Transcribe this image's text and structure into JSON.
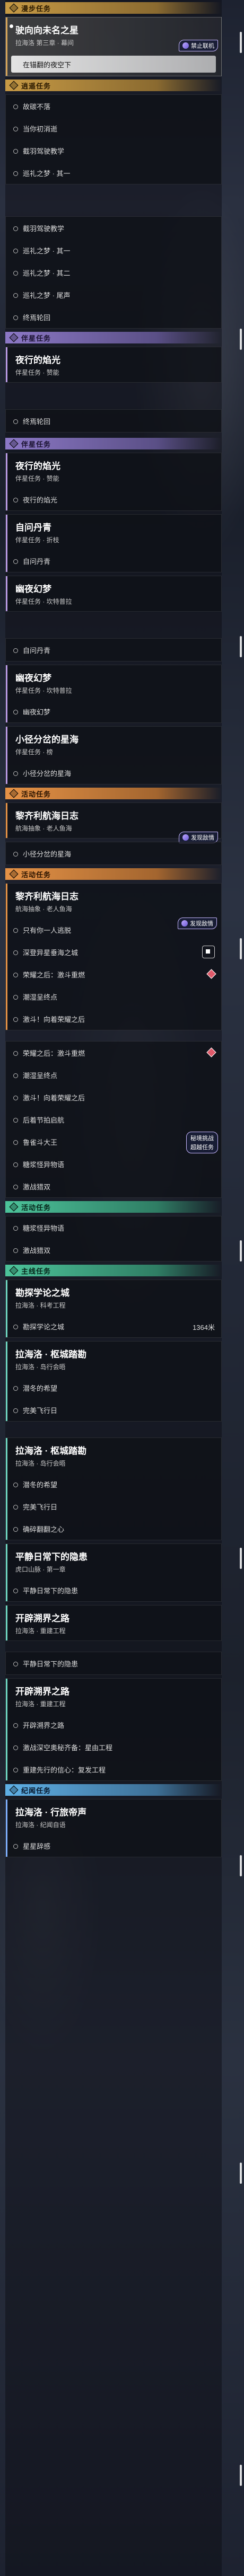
{
  "sections": {
    "daily": "漫步任务",
    "companion": "逍遥任务",
    "companion_repeat": "伴星任务",
    "activity": "活动任务",
    "main": "主线任务",
    "event": "纪闻任务"
  },
  "items": {
    "i1_title": "驶向向未名之星",
    "i1_sub": "拉海洛 第三章 · 幕间",
    "i1_tracked": "在锚翻的夜空下",
    "i2a": "故碳不落",
    "i2b": "当你初消逝",
    "i2c": "截羽驾驶教学",
    "i2d": "巡礼之梦 · 其一",
    "i3a": "截羽驾驶教学",
    "i3b": "巡礼之梦 · 其一",
    "i3c": "巡礼之梦 · 其二",
    "i3d": "巡礼之梦 · 尾声",
    "i3e": "终焉轮回",
    "i4_title": "夜行的焰光",
    "i4_sub": "伴星任务 · 赞能",
    "i4a": "终焉轮回",
    "i5_title": "夜行的焰光",
    "i5_sub": "伴星任务 · 赞能",
    "i5a": "夜行的焰光",
    "i6_title": "自问丹青",
    "i6_sub": "伴星任务 · 折枝",
    "i6a": "自问丹青",
    "i7_title": "幽夜幻梦",
    "i7_sub": "伴星任务 · 坎特普拉",
    "i8a": "自问丹青",
    "i9_title": "幽夜幻梦",
    "i9_sub": "伴星任务 · 坎特普拉",
    "i9a": "幽夜幻梦",
    "i10_title": "小径分岔的星海",
    "i10_sub": "伴星任务 · 榜",
    "i10a": "小径分岔的星海",
    "i11_title": "黎齐利航海日志",
    "i11_sub": "航海抽象 · 老人鱼海",
    "i11a": "小径分岔的星海",
    "i12_title": "黎齐利航海日志",
    "i12_sub": "航海抽象 · 老人鱼海",
    "i12a": "只有你一人逃脱",
    "i12b": "深登异星垂海之城",
    "i12c": "荣耀之后：激斗重燃",
    "i12d": "潮湿呈终点",
    "i12e": "激斗！向着荣耀之后",
    "i13a": "荣耀之后：激斗重燃",
    "i13b": "潮湿呈终点",
    "i13c": "激斗！向着荣耀之后",
    "i13d": "后着节拍启航",
    "i13e": "鲁雀斗大王",
    "i13f": "糖浆怪异物语",
    "i13g": "激战猎双",
    "i14a": "糖浆怪异物语",
    "i14b": "激战猎双",
    "i15_title": "勘探学论之城",
    "i15_sub": "拉海洛 · 科考工程",
    "i15a": "勘探学论之城",
    "i15a_num": "1364米",
    "i16_title": "拉海洛 · 枢城踏勘",
    "i16_sub": "拉海洛 · 岛行会晤",
    "i16a": "潜冬的希望",
    "i16b": "完美飞行日",
    "i17_title": "拉海洛 · 枢城踏勘",
    "i17_sub": "拉海洛 · 岛行会晤",
    "i17a": "潜冬的希望",
    "i17b": "完美飞行日",
    "i17c": "确碎翻翻之心",
    "i18_title": "平静日常下的隐患",
    "i18_sub": "虎口山脉 · 第一章",
    "i18a": "平静日常下的隐患",
    "i19_title": "开辟溯界之路",
    "i19_sub": "拉海洛 · 重建工程",
    "i19a": "平静日常下的隐患",
    "i20_title": "开辟溯界之路",
    "i20_sub": "拉海洛 · 重建工程",
    "i20a": "开辟溯界之路",
    "i20b": "激战深空奥秘齐备：星由工程",
    "i20c": "重建先行的信心：复发工程",
    "i21_title": "拉海洛 · 行旅帝声",
    "i21_sub": "拉海洛 · 纪闻自语",
    "i21a": "星星辞感"
  },
  "badges": {
    "offline": "禁止联机",
    "wait": "发现敌情",
    "wait2": "秘境挑战",
    "wait3": "超越任务"
  }
}
